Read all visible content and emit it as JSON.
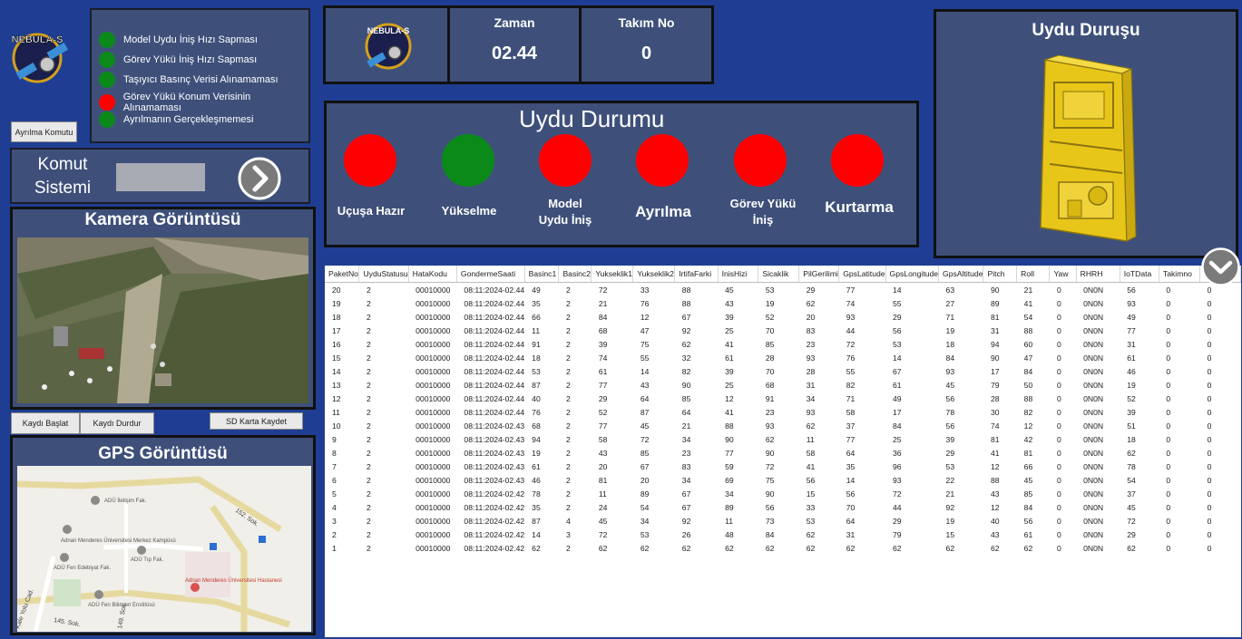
{
  "logo": {
    "text": "NEBULA-S"
  },
  "alerts": [
    {
      "label": "Model Uydu İniş Hızı Sapması",
      "color": "#0b8a1a"
    },
    {
      "label": "Görev Yükü İniş Hızı Sapması",
      "color": "#0b8a1a"
    },
    {
      "label": "Taşıyıcı Basınç Verisi Alınamaması",
      "color": "#0b8a1a"
    },
    {
      "label": "Görev Yükü Konum Verisinin Alınamaması",
      "color": "#ff0000"
    },
    {
      "label": "Ayrılmanın Gerçekleşmemesi",
      "color": "#0b8a1a"
    }
  ],
  "buttons": {
    "ayrilma": "Ayrılma Komutu",
    "kayit_baslat": "Kaydı Başlat",
    "kayit_durdur": "Kaydı Durdur",
    "sd_kaydet": "SD Karta Kaydet"
  },
  "komut": {
    "title_line1": "Komut",
    "title_line2": "Sistemi",
    "input_value": ""
  },
  "kamera": {
    "title": "Kamera Görüntüsü"
  },
  "gps": {
    "title": "GPS Görüntüsü",
    "labels": [
      "ADÜ İletişim Fak.",
      "Adnan Menderes Üniversitesi Merkez Kampüsü",
      "ADÜ Tıp Fak.",
      "ADÜ Fen Edebiyat Fak.",
      "Adnan Menderes Üniversitesi Hastanesi",
      "ADÜ Fen Bilimleri Enstitüsü",
      "152. Sok.",
      "145. Sok.",
      "Kale Yolu Cad.",
      "149. Sok."
    ]
  },
  "zaman": {
    "label": "Zaman",
    "value": "02.44"
  },
  "takim": {
    "label": "Takım No",
    "value": "0"
  },
  "uydu_durumu": {
    "title": "Uydu Durumu",
    "states": [
      {
        "label": "Uçuşa Hazır",
        "color": "#ff0000"
      },
      {
        "label": "Yükselme",
        "color": "#0b8a1a"
      },
      {
        "label": "Model Uydu İniş",
        "color": "#ff0000"
      },
      {
        "label": "Ayrılma",
        "color": "#ff0000"
      },
      {
        "label": "Görev Yükü İniş",
        "color": "#ff0000"
      },
      {
        "label": "Kurtarma",
        "color": "#ff0000"
      }
    ]
  },
  "uydu_durusu": {
    "title": "Uydu Duruşu"
  },
  "table": {
    "columns": [
      "PaketNo",
      "UyduStatusu",
      "HataKodu",
      "GondermeSaati",
      "Basinc1",
      "Basinc2",
      "Yukseklik1",
      "Yukseklik2",
      "IrtifaFarki",
      "InisHizi",
      "Sicaklik",
      "PilGerilimi",
      "GpsLatitude",
      "GpsLongitude",
      "GpsAltitude",
      "Pitch",
      "Roll",
      "Yaw",
      "RHRH",
      "IoTData",
      "Takimno",
      "Ayrilma"
    ],
    "rows": [
      [
        "20",
        "2",
        "00010000",
        "08:11:2024-02.44",
        "49",
        "2",
        "72",
        "33",
        "88",
        "45",
        "53",
        "29",
        "77",
        "14",
        "63",
        "90",
        "21",
        "0",
        "0N0N",
        "56",
        "0",
        "0"
      ],
      [
        "19",
        "2",
        "00010000",
        "08:11:2024-02.44",
        "35",
        "2",
        "21",
        "76",
        "88",
        "43",
        "19",
        "62",
        "74",
        "55",
        "27",
        "89",
        "41",
        "0",
        "0N0N",
        "93",
        "0",
        "0"
      ],
      [
        "18",
        "2",
        "00010000",
        "08:11:2024-02.44",
        "66",
        "2",
        "84",
        "12",
        "67",
        "39",
        "52",
        "20",
        "93",
        "29",
        "71",
        "81",
        "54",
        "0",
        "0N0N",
        "49",
        "0",
        "0"
      ],
      [
        "17",
        "2",
        "00010000",
        "08:11:2024-02.44",
        "11",
        "2",
        "68",
        "47",
        "92",
        "25",
        "70",
        "83",
        "44",
        "56",
        "19",
        "31",
        "88",
        "0",
        "0N0N",
        "77",
        "0",
        "0"
      ],
      [
        "16",
        "2",
        "00010000",
        "08:11:2024-02.44",
        "91",
        "2",
        "39",
        "75",
        "62",
        "41",
        "85",
        "23",
        "72",
        "53",
        "18",
        "94",
        "60",
        "0",
        "0N0N",
        "31",
        "0",
        "0"
      ],
      [
        "15",
        "2",
        "00010000",
        "08:11:2024-02.44",
        "18",
        "2",
        "74",
        "55",
        "32",
        "61",
        "28",
        "93",
        "76",
        "14",
        "84",
        "90",
        "47",
        "0",
        "0N0N",
        "61",
        "0",
        "0"
      ],
      [
        "14",
        "2",
        "00010000",
        "08:11:2024-02.44",
        "53",
        "2",
        "61",
        "14",
        "82",
        "39",
        "70",
        "28",
        "55",
        "67",
        "93",
        "17",
        "84",
        "0",
        "0N0N",
        "46",
        "0",
        "0"
      ],
      [
        "13",
        "2",
        "00010000",
        "08:11:2024-02.44",
        "87",
        "2",
        "77",
        "43",
        "90",
        "25",
        "68",
        "31",
        "82",
        "61",
        "45",
        "79",
        "50",
        "0",
        "0N0N",
        "19",
        "0",
        "0"
      ],
      [
        "12",
        "2",
        "00010000",
        "08:11:2024-02.44",
        "40",
        "2",
        "29",
        "64",
        "85",
        "12",
        "91",
        "34",
        "71",
        "49",
        "56",
        "28",
        "88",
        "0",
        "0N0N",
        "52",
        "0",
        "0"
      ],
      [
        "11",
        "2",
        "00010000",
        "08:11:2024-02.44",
        "76",
        "2",
        "52",
        "87",
        "64",
        "41",
        "23",
        "93",
        "58",
        "17",
        "78",
        "30",
        "82",
        "0",
        "0N0N",
        "39",
        "0",
        "0"
      ],
      [
        "10",
        "2",
        "00010000",
        "08:11:2024-02.43",
        "68",
        "2",
        "77",
        "45",
        "21",
        "88",
        "93",
        "62",
        "37",
        "84",
        "56",
        "74",
        "12",
        "0",
        "0N0N",
        "51",
        "0",
        "0"
      ],
      [
        "9",
        "2",
        "00010000",
        "08:11:2024-02.43",
        "94",
        "2",
        "58",
        "72",
        "34",
        "90",
        "62",
        "11",
        "77",
        "25",
        "39",
        "81",
        "42",
        "0",
        "0N0N",
        "18",
        "0",
        "0"
      ],
      [
        "8",
        "2",
        "00010000",
        "08:11:2024-02.43",
        "19",
        "2",
        "43",
        "85",
        "23",
        "77",
        "90",
        "58",
        "64",
        "36",
        "29",
        "41",
        "81",
        "0",
        "0N0N",
        "62",
        "0",
        "0"
      ],
      [
        "7",
        "2",
        "00010000",
        "08:11:2024-02.43",
        "61",
        "2",
        "20",
        "67",
        "83",
        "59",
        "72",
        "41",
        "35",
        "96",
        "53",
        "12",
        "66",
        "0",
        "0N0N",
        "78",
        "0",
        "0"
      ],
      [
        "6",
        "2",
        "00010000",
        "08:11:2024-02.43",
        "46",
        "2",
        "81",
        "20",
        "34",
        "69",
        "75",
        "56",
        "14",
        "93",
        "22",
        "88",
        "45",
        "0",
        "0N0N",
        "54",
        "0",
        "0"
      ],
      [
        "5",
        "2",
        "00010000",
        "08:11:2024-02.42",
        "78",
        "2",
        "11",
        "89",
        "67",
        "34",
        "90",
        "15",
        "56",
        "72",
        "21",
        "43",
        "85",
        "0",
        "0N0N",
        "37",
        "0",
        "0"
      ],
      [
        "4",
        "2",
        "00010000",
        "08:11:2024-02.42",
        "35",
        "2",
        "24",
        "54",
        "67",
        "89",
        "56",
        "33",
        "70",
        "44",
        "92",
        "12",
        "84",
        "0",
        "0N0N",
        "45",
        "0",
        "0"
      ],
      [
        "3",
        "2",
        "00010000",
        "08:11:2024-02.42",
        "87",
        "4",
        "45",
        "34",
        "92",
        "11",
        "73",
        "53",
        "64",
        "29",
        "19",
        "40",
        "56",
        "0",
        "0N0N",
        "72",
        "0",
        "0"
      ],
      [
        "2",
        "2",
        "00010000",
        "08:11:2024-02.42",
        "14",
        "3",
        "72",
        "53",
        "26",
        "48",
        "84",
        "62",
        "31",
        "79",
        "15",
        "43",
        "61",
        "0",
        "0N0N",
        "29",
        "0",
        "0"
      ],
      [
        "1",
        "2",
        "00010000",
        "08:11:2024-02.42",
        "62",
        "2",
        "62",
        "62",
        "62",
        "62",
        "62",
        "62",
        "62",
        "62",
        "62",
        "62",
        "62",
        "0",
        "0N0N",
        "62",
        "0",
        "0"
      ]
    ]
  }
}
